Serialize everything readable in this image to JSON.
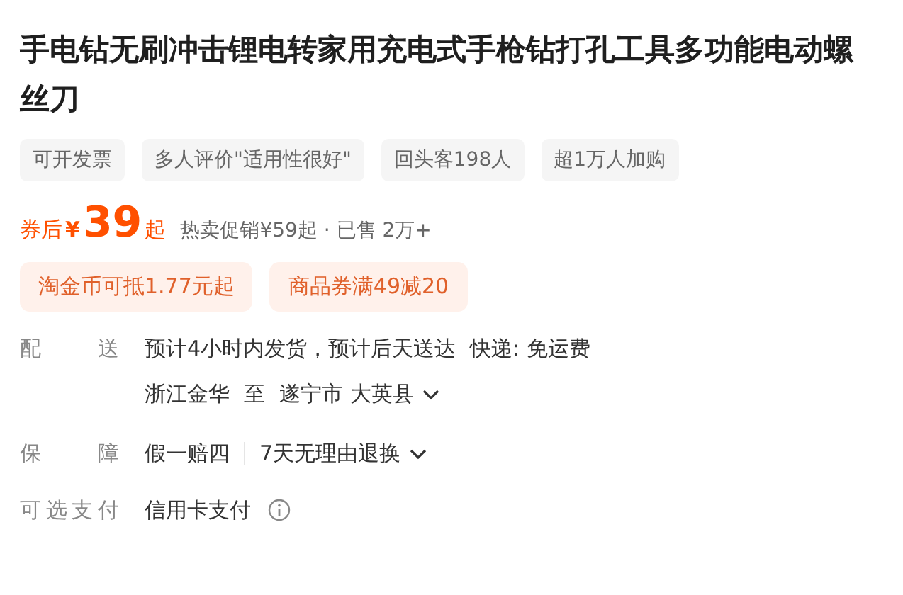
{
  "title": "手电钻无刷冲击锂电转家用充电式手枪钻打孔工具多功能电动螺丝刀",
  "tags": [
    "可开发票",
    "多人评价\"适用性很好\"",
    "回头客198人",
    "超1万人加购"
  ],
  "price": {
    "prefix": "券后",
    "currency": "¥",
    "amount": "39",
    "suffix": "起",
    "note": "热卖促销¥59起 · 已售 2万+"
  },
  "coupons": [
    "淘金币可抵1.77元起",
    "商品券满49减20"
  ],
  "delivery": {
    "label": "配送",
    "estimate": "预计4小时内发货，预计后天送达",
    "shipping": "快递: 免运费",
    "from": "浙江金华",
    "to_word": "至",
    "to": "遂宁市 大英县"
  },
  "guarantee": {
    "label": "保障",
    "items": [
      "假一赔四",
      "7天无理由退换"
    ]
  },
  "payment": {
    "label": "可选支付",
    "method": "信用卡支付"
  }
}
